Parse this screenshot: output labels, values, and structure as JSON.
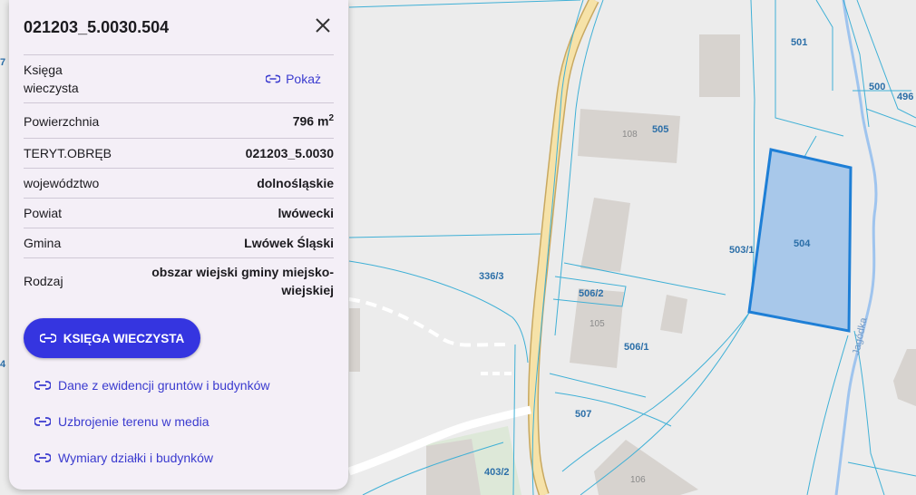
{
  "panel": {
    "title": "021203_5.0030.504",
    "rows": {
      "ksiega_label": "Księga\nwieczysta",
      "ksiega_link": "Pokaż",
      "powierzchnia_label": "Powierzchnia",
      "powierzchnia_value": "796 m",
      "powierzchnia_sup": "2",
      "teryt_label": "TERYT.OBRĘB",
      "teryt_value": "021203_5.0030",
      "woj_label": "województwo",
      "woj_value": "dolnośląskie",
      "powiat_label": "Powiat",
      "powiat_value": "lwówecki",
      "gmina_label": "Gmina",
      "gmina_value": "Lwówek Śląski",
      "rodzaj_label": "Rodzaj",
      "rodzaj_value": "obszar wiejski gminy miejsko-wiejskiej"
    },
    "primary_button": "KSIĘGA WIECZYSTA",
    "links": [
      "Dane z ewidencji gruntów i budynków",
      "Uzbrojenie terenu w media",
      "Wymiary działki i budynków"
    ],
    "icons": {
      "close": "close-icon",
      "link": "link-icon"
    }
  },
  "map": {
    "parcel_labels": {
      "p501": "501",
      "p500": "500",
      "p496": "496",
      "p505": "505",
      "p504": "504",
      "p503_1": "503/1",
      "p336_3": "336/3",
      "p506_2": "506/2",
      "p506_1": "506/1",
      "p507": "507",
      "p403_2": "403/2",
      "edge_7": "7",
      "edge_4": "4"
    },
    "building_labels": {
      "b108": "108",
      "b105": "105",
      "b106": "106"
    },
    "stream_name": "Jagódka",
    "colors": {
      "selected_fill": "#a8c8ea",
      "selected_stroke": "#1e7fd6",
      "parcel_line": "#3fb0d6",
      "road": "#f6e2a8",
      "accent": "#3535e0"
    }
  }
}
